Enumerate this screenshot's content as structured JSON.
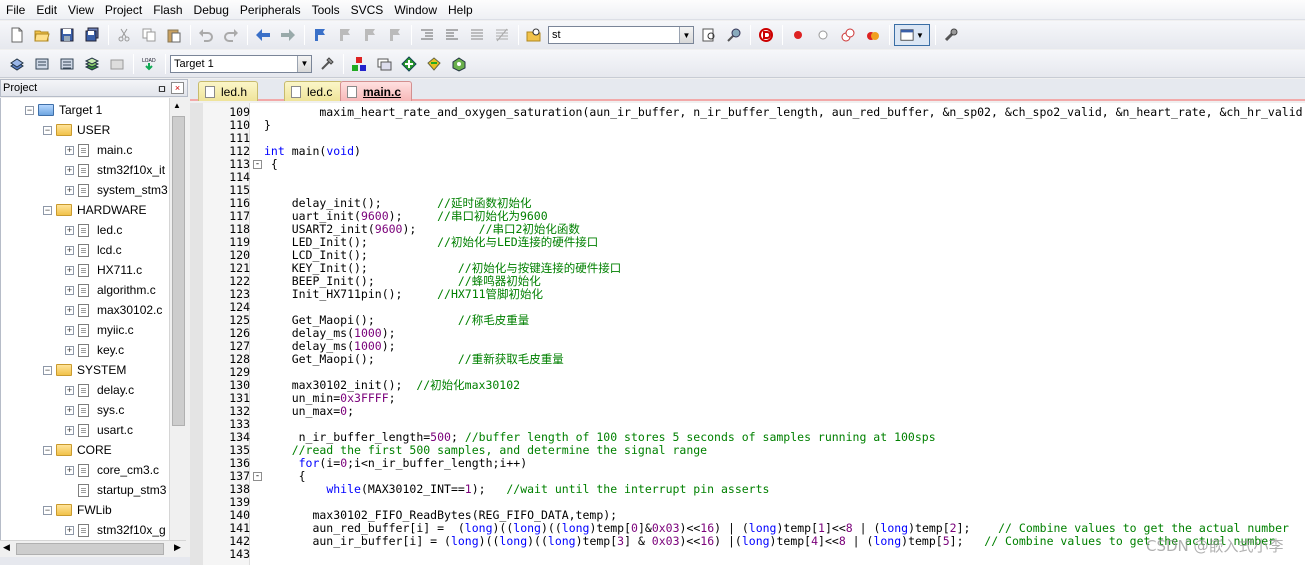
{
  "menu": [
    "File",
    "Edit",
    "View",
    "Project",
    "Flash",
    "Debug",
    "Peripherals",
    "Tools",
    "SVCS",
    "Window",
    "Help"
  ],
  "toolbar": {
    "find_combo_value": "st",
    "target_combo_value": "Target 1"
  },
  "project_panel": {
    "title": "Project",
    "pin_glyph": "ㅁ",
    "close_glyph": "×",
    "tree": [
      {
        "label": "Target 1",
        "level": 1,
        "type": "target"
      },
      {
        "label": "USER",
        "level": 2,
        "type": "folder"
      },
      {
        "label": "main.c",
        "level": 3,
        "type": "file"
      },
      {
        "label": "stm32f10x_it",
        "level": 3,
        "type": "file"
      },
      {
        "label": "system_stm3",
        "level": 3,
        "type": "file"
      },
      {
        "label": "HARDWARE",
        "level": 2,
        "type": "folder"
      },
      {
        "label": "led.c",
        "level": 3,
        "type": "file"
      },
      {
        "label": "lcd.c",
        "level": 3,
        "type": "file"
      },
      {
        "label": "HX711.c",
        "level": 3,
        "type": "file"
      },
      {
        "label": "algorithm.c",
        "level": 3,
        "type": "file"
      },
      {
        "label": "max30102.c",
        "level": 3,
        "type": "file"
      },
      {
        "label": "myiic.c",
        "level": 3,
        "type": "file"
      },
      {
        "label": "key.c",
        "level": 3,
        "type": "file"
      },
      {
        "label": "SYSTEM",
        "level": 2,
        "type": "folder"
      },
      {
        "label": "delay.c",
        "level": 3,
        "type": "file"
      },
      {
        "label": "sys.c",
        "level": 3,
        "type": "file"
      },
      {
        "label": "usart.c",
        "level": 3,
        "type": "file"
      },
      {
        "label": "CORE",
        "level": 2,
        "type": "folder"
      },
      {
        "label": "core_cm3.c",
        "level": 3,
        "type": "file"
      },
      {
        "label": "startup_stm3",
        "level": 3,
        "type": "file-noexp"
      },
      {
        "label": "FWLib",
        "level": 2,
        "type": "folder"
      },
      {
        "label": "stm32f10x_g",
        "level": 3,
        "type": "file"
      }
    ]
  },
  "tabs": [
    {
      "label": "led.h",
      "active": false
    },
    {
      "label": "led.c",
      "active": false
    },
    {
      "label": "main.c",
      "active": true
    }
  ],
  "editor_lines": [
    {
      "n": "109",
      "parts": [
        [
          "",
          "        maxim_heart_rate_and_oxygen_saturation(aun_ir_buffer, n_ir_buffer_length, aun_red_buffer, &n_sp02, &ch_spo2_valid, &n_heart_rate, &ch_hr_valid"
        ]
      ]
    },
    {
      "n": "110",
      "parts": [
        [
          "",
          "}"
        ]
      ]
    },
    {
      "n": "111",
      "parts": []
    },
    {
      "n": "112",
      "parts": [
        [
          "kw",
          "int"
        ],
        [
          "",
          " main("
        ],
        [
          "kw",
          "void"
        ],
        [
          "",
          ")"
        ]
      ]
    },
    {
      "n": "113",
      "parts": [
        [
          "",
          " {"
        ]
      ],
      "fold": "-"
    },
    {
      "n": "114",
      "parts": []
    },
    {
      "n": "115",
      "parts": []
    },
    {
      "n": "116",
      "parts": [
        [
          "",
          "    delay_init();        "
        ],
        [
          "cm",
          "//延时函数初始化"
        ]
      ]
    },
    {
      "n": "117",
      "parts": [
        [
          "",
          "    uart_init("
        ],
        [
          "num",
          "9600"
        ],
        [
          "",
          ");     "
        ],
        [
          "cm",
          "//串口初始化为9600"
        ]
      ]
    },
    {
      "n": "118",
      "parts": [
        [
          "",
          "    USART2_init("
        ],
        [
          "num",
          "9600"
        ],
        [
          "",
          ");         "
        ],
        [
          "cm",
          "//串口2初始化函数"
        ]
      ]
    },
    {
      "n": "119",
      "parts": [
        [
          "",
          "    LED_Init();          "
        ],
        [
          "cm",
          "//初始化与LED连接的硬件接口"
        ]
      ]
    },
    {
      "n": "120",
      "parts": [
        [
          "",
          "    LCD_Init();"
        ]
      ]
    },
    {
      "n": "121",
      "parts": [
        [
          "",
          "    KEY_Init();             "
        ],
        [
          "cm",
          "//初始化与按键连接的硬件接口"
        ]
      ]
    },
    {
      "n": "122",
      "parts": [
        [
          "",
          "    BEEP_Init();            "
        ],
        [
          "cm",
          "//蜂鸣器初始化"
        ]
      ]
    },
    {
      "n": "123",
      "parts": [
        [
          "",
          "    Init_HX711pin();     "
        ],
        [
          "cm",
          "//HX711管脚初始化"
        ]
      ]
    },
    {
      "n": "124",
      "parts": []
    },
    {
      "n": "125",
      "parts": [
        [
          "",
          "    Get_Maopi();            "
        ],
        [
          "cm",
          "//称毛皮重量"
        ]
      ]
    },
    {
      "n": "126",
      "parts": [
        [
          "",
          "    delay_ms("
        ],
        [
          "num",
          "1000"
        ],
        [
          "",
          ");"
        ]
      ]
    },
    {
      "n": "127",
      "parts": [
        [
          "",
          "    delay_ms("
        ],
        [
          "num",
          "1000"
        ],
        [
          "",
          ");"
        ]
      ]
    },
    {
      "n": "128",
      "parts": [
        [
          "",
          "    Get_Maopi();            "
        ],
        [
          "cm",
          "//重新获取毛皮重量"
        ]
      ]
    },
    {
      "n": "129",
      "parts": []
    },
    {
      "n": "130",
      "parts": [
        [
          "",
          "    max30102_init();  "
        ],
        [
          "cm",
          "//初始化max30102"
        ]
      ]
    },
    {
      "n": "131",
      "parts": [
        [
          "",
          "    un_min="
        ],
        [
          "num",
          "0x3FFFF"
        ],
        [
          "",
          ";"
        ]
      ]
    },
    {
      "n": "132",
      "parts": [
        [
          "",
          "    un_max="
        ],
        [
          "num",
          "0"
        ],
        [
          "",
          ";"
        ]
      ]
    },
    {
      "n": "133",
      "parts": []
    },
    {
      "n": "134",
      "parts": [
        [
          "",
          "     n_ir_buffer_length="
        ],
        [
          "num",
          "500"
        ],
        [
          "",
          "; "
        ],
        [
          "cm",
          "//buffer length of 100 stores 5 seconds of samples running at 100sps"
        ]
      ]
    },
    {
      "n": "135",
      "parts": [
        [
          "cm",
          "    //read the first 500 samples, and determine the signal range"
        ]
      ]
    },
    {
      "n": "136",
      "parts": [
        [
          "",
          "     "
        ],
        [
          "kw",
          "for"
        ],
        [
          "",
          "(i="
        ],
        [
          "num",
          "0"
        ],
        [
          "",
          ";i<n_ir_buffer_length;i++)"
        ]
      ]
    },
    {
      "n": "137",
      "parts": [
        [
          "",
          "     {"
        ]
      ],
      "fold": "-"
    },
    {
      "n": "138",
      "parts": [
        [
          "",
          "         "
        ],
        [
          "kw",
          "while"
        ],
        [
          "",
          "(MAX30102_INT=="
        ],
        [
          "num",
          "1"
        ],
        [
          "",
          ");   "
        ],
        [
          "cm",
          "//wait until the interrupt pin asserts"
        ]
      ]
    },
    {
      "n": "139",
      "parts": []
    },
    {
      "n": "140",
      "parts": [
        [
          "",
          "       max30102_FIFO_ReadBytes(REG_FIFO_DATA,temp);"
        ]
      ]
    },
    {
      "n": "141",
      "parts": [
        [
          "",
          "       aun_red_buffer[i] =  ("
        ],
        [
          "kw",
          "long"
        ],
        [
          "",
          ")(("
        ],
        [
          "kw",
          "long"
        ],
        [
          "",
          ")(("
        ],
        [
          "kw",
          "long"
        ],
        [
          "",
          ")temp["
        ],
        [
          "num",
          "0"
        ],
        [
          "",
          "]&"
        ],
        [
          "num",
          "0x03"
        ],
        [
          "",
          ")<<"
        ],
        [
          "num",
          "16"
        ],
        [
          "",
          ") | ("
        ],
        [
          "kw",
          "long"
        ],
        [
          "",
          ")temp["
        ],
        [
          "num",
          "1"
        ],
        [
          "",
          "]<<"
        ],
        [
          "num",
          "8"
        ],
        [
          "",
          " | ("
        ],
        [
          "kw",
          "long"
        ],
        [
          "",
          ")temp["
        ],
        [
          "num",
          "2"
        ],
        [
          "",
          "];    "
        ],
        [
          "cm",
          "// Combine values to get the actual number"
        ]
      ]
    },
    {
      "n": "142",
      "parts": [
        [
          "",
          "       aun_ir_buffer[i] = ("
        ],
        [
          "kw",
          "long"
        ],
        [
          "",
          ")(("
        ],
        [
          "kw",
          "long"
        ],
        [
          "",
          ")(("
        ],
        [
          "kw",
          "long"
        ],
        [
          "",
          ")temp["
        ],
        [
          "num",
          "3"
        ],
        [
          "",
          "] & "
        ],
        [
          "num",
          "0x03"
        ],
        [
          "",
          ")<<"
        ],
        [
          "num",
          "16"
        ],
        [
          "",
          ") |("
        ],
        [
          "kw",
          "long"
        ],
        [
          "",
          ")temp["
        ],
        [
          "num",
          "4"
        ],
        [
          "",
          "]<<"
        ],
        [
          "num",
          "8"
        ],
        [
          "",
          " | ("
        ],
        [
          "kw",
          "long"
        ],
        [
          "",
          ")temp["
        ],
        [
          "num",
          "5"
        ],
        [
          "",
          "];   "
        ],
        [
          "cm",
          "// Combine values to get the actual number"
        ]
      ]
    },
    {
      "n": "143",
      "parts": []
    }
  ],
  "watermark": "CSDN @嵌入式小李"
}
